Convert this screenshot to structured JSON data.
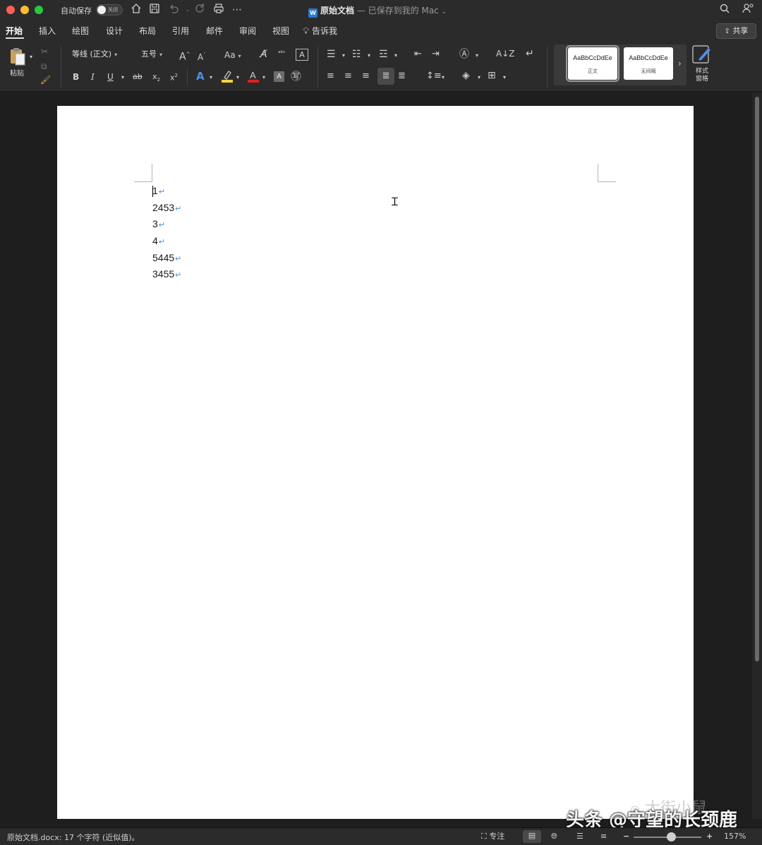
{
  "titlebar": {
    "autosave_label": "自动保存",
    "autosave_state": "关闭",
    "doc_name": "原始文档",
    "saved_status": "— 已保存到我的 Mac"
  },
  "tabs": [
    "开始",
    "插入",
    "绘图",
    "设计",
    "布局",
    "引用",
    "邮件",
    "审阅",
    "视图"
  ],
  "tell_me": "告诉我",
  "share_label": "共享",
  "ribbon": {
    "paste_label": "粘贴",
    "font_name": "等线 (正文)",
    "font_size": "五号",
    "change_case": "Aa",
    "styles": [
      {
        "sample": "AaBbCcDdEe",
        "name": "正文"
      },
      {
        "sample": "AaBbCcDdEe",
        "name": "无间隔"
      }
    ],
    "styles_pane": "样式\n窗格"
  },
  "document": {
    "lines": [
      "1",
      "2453",
      "3",
      "4",
      "5445",
      "3455"
    ],
    "paragraph_mark": "↵"
  },
  "statusbar": {
    "text": "原始文档.docx: 17 个字符 (近似值)。",
    "focus": "专注",
    "zoom": "157%"
  },
  "watermark": {
    "text": "头条 @守望的长颈鹿",
    "faint_text": "大街小鼠"
  },
  "colors": {
    "highlight": "#f3d43b",
    "font_color": "#e02020",
    "word_blue": "#2b78d6"
  }
}
